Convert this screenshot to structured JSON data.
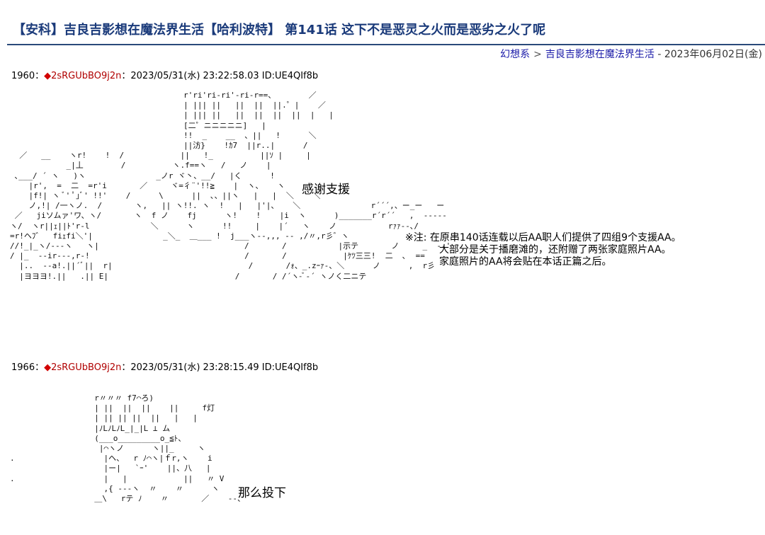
{
  "page": {
    "title": "【安科】吉良吉影想在魔法界生活【哈利波特】 第141话 这下不是恶灵之火而是恶劣之火了呢"
  },
  "breadcrumb": {
    "site": "幻想系",
    "separator": ">",
    "series": "吉良吉影想在魔法界生活",
    "date": "- 2023年06月02日(金)"
  },
  "posts": [
    {
      "number": "1960",
      "colon": "：",
      "diamond": "◆",
      "trip": "2sRGUbBO9j2n",
      "meta": "：2023/05/31(水) 23:22:58.03 ID:UE4QIf8b",
      "caption": "感谢支援",
      "note": {
        "line1": "※注:  在原串140话连载以后AA职人们提供了四组9个支援AA。",
        "line2": "大部分是关于播磨滩的，还附赠了两张家庭照片AA。",
        "line3": "家庭照片的AA将会贴在本话正篇之后。"
      }
    },
    {
      "number": "1966",
      "colon": "：",
      "diamond": "◆",
      "trip": "2sRGUbBO9j2n",
      "meta": "：2023/05/31(水) 23:28:15.49 ID:UE4QIf8b",
      "caption": "那么投下"
    }
  ],
  "ascii_art": {
    "art1": "                                     r'ri'ri-ri'-ri-r==、       ／\n                                     | ||| ||   ||  ||  ||.゜|    ／\n                                     | ||| ||   ||  ||  ||  ||  |   |\n                                     [二゜ニニニニニ]   |\n                                     !!  _    __  、||   !      ＼\n                                     ||汸}    !ｶ7  ||r..|      /\n  ／   __    ヽr!    !  /            ||   !_          ||ｿ |     |\n            _|丄        /          ヽ.f==ヽ   /   ノ    |\n ､___/ ´ ヽ   )ヽ               _ノr ヾ丶、__/   |く      !\n    |r',  =  二  =r'i       ／     ヾ=彳¨'!!≧    |  ヽ、   ヽ\n    |f!| ヽ ﾞ' ﾟ｣ﾞ' !!'    /      \\      ||  ､、||ヽ   |   |  ＼    ＼\n    ノ,!| /一ヽノ.  /       ヽ,   || ヽ!!. ヽ  !   |   |'|、   ＼               r´´´,、ー_ー   ー\n ／   jiソムァ'ワ、ヽ/       ヽ  f ノ    fj      ヽ!    !    |i  ヽ      )_______r´r´´   ,  -----\nヽ/  ヽr||ｪ||ﾄ'r-l             ＼      ヽ      !!     |    |´   ヽ    ノ           rｧｧ--､/\n=r!ヘﾌ゛  fiｪfi＼'|               _＼_  ＿___ !  j___ヽ--,,, -- ,/〃,r彡゛ヽ\n//!_|_ヽ/---ヽ   ヽ|                               /       /           |示テ       ノ     _  --'\n/ |_  --ir---,r-!                                 /       /            |ｹﾂ三三!  二  ､  ==\n  |..  --a!.||´ﾞ||  r|                             /       /ｫ、_.zｰｧ-、＼      ノ      ,  r彡\n  |ヨヨヨ!.||   .|| E|                           /       / /´ヽ-ﾞ-´ ヽノく二ニテ",
    "art2": "                  r〃〃〃 f7⌒ろ)\n                  | ||  ||  ||    ||     f灯\n                  | || || ||  ||   |   |\n                  |ﾉLﾉLﾉL_|_|L ⊥ ム\n                  (___o_________o_≦ﾄ、\n                   |⌒ヽノ      ヽ||_     ヽ\n.                   |ヘ、  r ﾉ⌒ヽ|ｆr,ヽ    i\n                    |ー|   `ｰ'    ||、八   |\n.                   |   |            ||   〃 V\n                    ,{ ---ヽ  〃    〃      ヽ\n                  ＿\\   rテ ﾉ    〃       ／    --、"
  }
}
